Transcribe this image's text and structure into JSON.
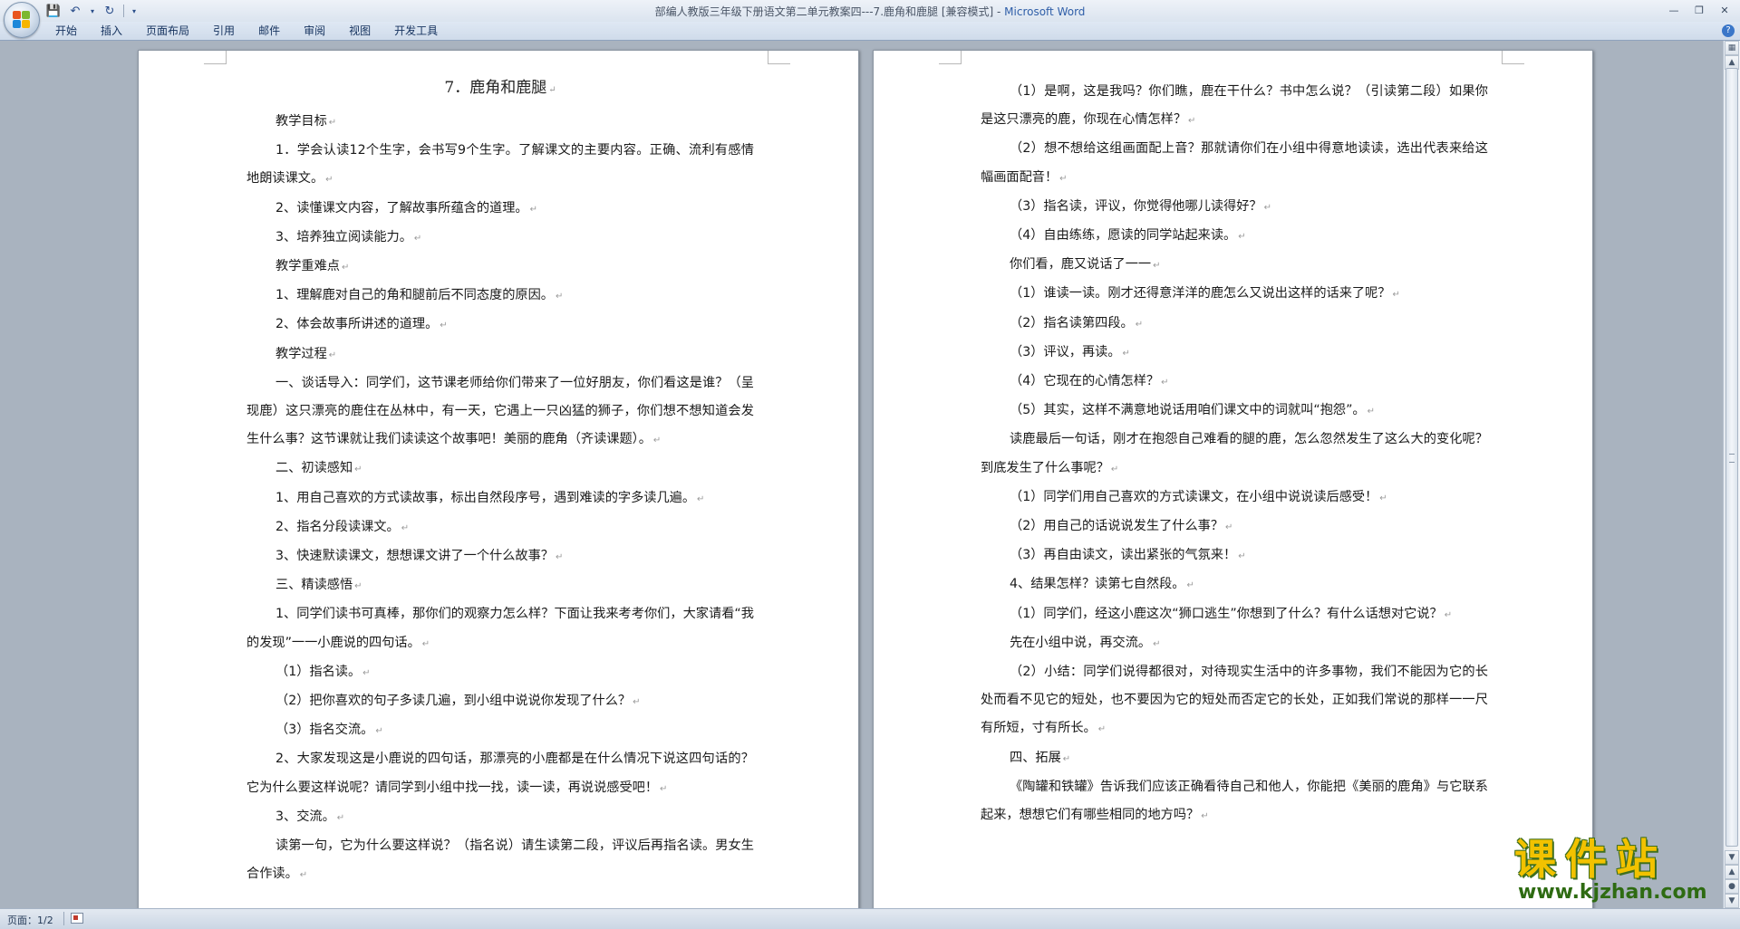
{
  "window": {
    "title": "部编人教版三年级下册语文第二单元教案四---7.鹿角和鹿腿 [兼容模式]",
    "app_name": "Microsoft Word",
    "title_separator": " - "
  },
  "quick_access": {
    "save": "save-icon",
    "undo": "undo-icon",
    "redo": "redo-icon",
    "customize": "dropdown-icon"
  },
  "ribbon": {
    "tabs": [
      "开始",
      "插入",
      "页面布局",
      "引用",
      "邮件",
      "审阅",
      "视图",
      "开发工具"
    ]
  },
  "document": {
    "left_page": {
      "title": "7．鹿角和鹿腿",
      "paragraphs": [
        "教学目标",
        "1．学会认读12个生字，会书写9个生字。了解课文的主要内容。正确、流利有感情地朗读课文。",
        "2、读懂课文内容，了解故事所蕴含的道理。",
        "3、培养独立阅读能力。",
        "教学重难点",
        "1、理解鹿对自己的角和腿前后不同态度的原因。",
        "2、体会故事所讲述的道理。",
        "教学过程",
        "一、谈话导入：同学们，这节课老师给你们带来了一位好朋友，你们看这是谁？（呈现鹿）这只漂亮的鹿住在丛林中，有一天，它遇上一只凶猛的狮子，你们想不想知道会发生什么事？这节课就让我们读读这个故事吧！美丽的鹿角（齐读课题）。",
        "二、初读感知",
        "1、用自己喜欢的方式读故事，标出自然段序号，遇到难读的字多读几遍。",
        "2、指名分段读课文。",
        "3、快速默读课文，想想课文讲了一个什么故事？",
        "三、精读感悟",
        "1、同学们读书可真棒，那你们的观察力怎么样？下面让我来考考你们，大家请看“我的发现”一一小鹿说的四句话。",
        "（1）指名读。",
        "（2）把你喜欢的句子多读几遍，到小组中说说你发现了什么？",
        "（3）指名交流。",
        "2、大家发现这是小鹿说的四句话，那漂亮的小鹿都是在什么情况下说这四句话的？它为什么要这样说呢？请同学到小组中找一找，读一读，再说说感受吧！",
        "3、交流。",
        "读第一句，它为什么要这样说？（指名说）请生读第二段，评议后再指名读。男女生合作读。"
      ]
    },
    "right_page": {
      "paragraphs": [
        "（1）是啊，这是我吗？你们瞧，鹿在干什么？书中怎么说？（引读第二段）如果你是这只漂亮的鹿，你现在心情怎样？",
        "（2）想不想给这组画面配上音？那就请你们在小组中得意地读读，选出代表来给这幅画面配音！",
        "（3）指名读，评议，你觉得他哪儿读得好？",
        "（4）自由练练，愿读的同学站起来读。",
        "你们看，鹿又说话了一一",
        "（1）谁读一读。刚才还得意洋洋的鹿怎么又说出这样的话来了呢？",
        "（2）指名读第四段。",
        "（3）评议，再读。",
        "（4）它现在的心情怎样？",
        "（5）其实，这样不满意地说话用咱们课文中的词就叫“抱怨”。",
        "读鹿最后一句话，刚才在抱怨自己难看的腿的鹿，怎么忽然发生了这么大的变化呢？到底发生了什么事呢？",
        "（1）同学们用自己喜欢的方式读课文，在小组中说说读后感受！",
        "（2）用自己的话说说发生了什么事？",
        "（3）再自由读文，读出紧张的气氛来！",
        "4、结果怎样？读第七自然段。",
        "（1）同学们，经这小鹿这次“狮口逃生”你想到了什么？有什么话想对它说？",
        "先在小组中说，再交流。",
        "（2）小结：同学们说得都很对，对待现实生活中的许多事物，我们不能因为它的长处而看不见它的短处，也不要因为它的短处而否定它的长处，正如我们常说的那样一一尺有所短，寸有所长。",
        "四、拓展",
        "《陶罐和铁罐》告诉我们应该正确看待自己和他人，你能把《美丽的鹿角》与它联系起来，想想它们有哪些相同的地方吗？"
      ]
    },
    "paragraph_mark": "↵"
  },
  "status_bar": {
    "page_info": "页面：1/2"
  },
  "watermark": {
    "main": "课件站",
    "url": "www.kjzhan.com"
  },
  "colors": {
    "background": "#a9b3bf",
    "title_accent": "#2f5ea8",
    "watermark_yellow": "#f2c200",
    "watermark_green": "#2e6b12"
  }
}
